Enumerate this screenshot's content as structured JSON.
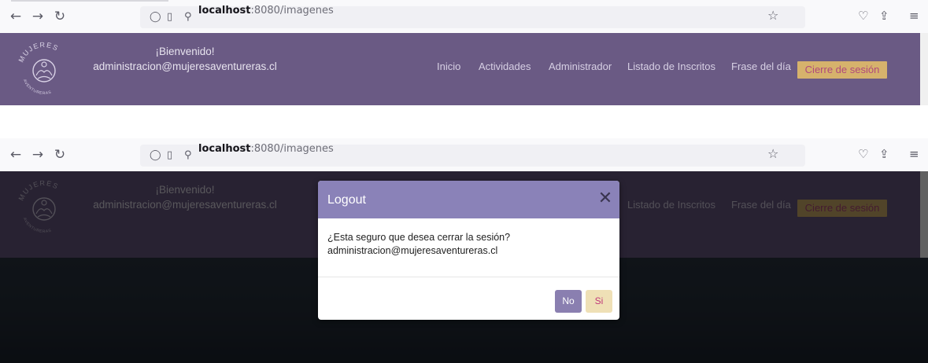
{
  "browser": {
    "url_host": "localhost",
    "url_path": ":8080/imagenes"
  },
  "site": {
    "logo_top_text": "MUJERES",
    "logo_bottom_text": "AVENTURERAS",
    "welcome": "¡Bienvenido!",
    "user_email": "administracion@mujeresaventureras.cl",
    "menu": {
      "inicio": "Inicio",
      "actividades": "Actividades",
      "administrador": "Administrador",
      "inscritos": "Listado de Inscritos",
      "frase": "Frase del día"
    },
    "logout_label": "Cierre de sesión"
  },
  "modal": {
    "title": "Logout",
    "message": "¿Esta seguro que desea cerrar la sesión?",
    "email": "administracion@mujeresaventureras.cl",
    "no_label": "No",
    "si_label": "Si"
  },
  "colors": {
    "header": "#6a5a84",
    "modal_header": "#8a82b8",
    "logout_button": "#d6b26c",
    "no_button": "#8a7fb0",
    "si_button": "#efe0b6"
  }
}
